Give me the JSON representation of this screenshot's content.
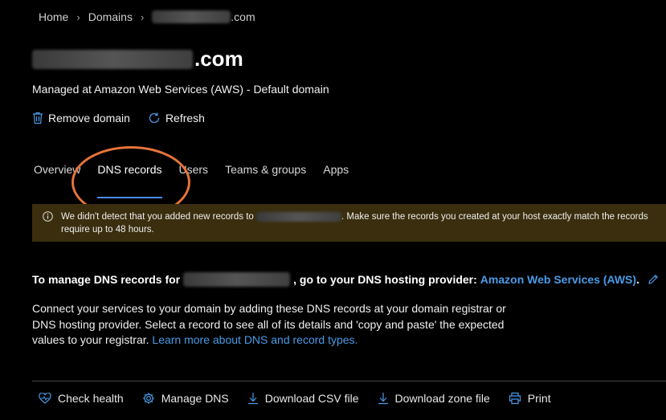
{
  "breadcrumb": {
    "home": "Home",
    "domains": "Domains",
    "domain_suffix": ".com"
  },
  "title": {
    "suffix": ".com"
  },
  "subtitle": "Managed at Amazon Web Services (AWS) - Default domain",
  "commands": {
    "remove": "Remove domain",
    "refresh": "Refresh"
  },
  "tabs": [
    "Overview",
    "DNS records",
    "Users",
    "Teams & groups",
    "Apps"
  ],
  "active_tab": "DNS records",
  "warning": {
    "part1": "We didn't detect that you added new records to",
    "part2": ". Make sure the records you created at your host exactly match the records",
    "line2": "require up to 48 hours."
  },
  "manage": {
    "prefix": "To manage DNS records for",
    "middle": ", go to your DNS hosting provider:",
    "provider": "Amazon Web Services (AWS)",
    "end": "."
  },
  "description": {
    "text": "Connect your services to your domain by adding these DNS records at your domain registrar or DNS hosting provider. Select a record to see all of its details and 'copy and paste' the expected values to your registrar.",
    "link": "Learn more about DNS and record types."
  },
  "bottom_commands": {
    "check_health": "Check health",
    "manage_dns": "Manage DNS",
    "download_csv": "Download CSV file",
    "download_zone": "Download zone file",
    "print": "Print"
  },
  "colors": {
    "accent": "#4a9be8",
    "annotation": "#e8743a",
    "warning_bg": "#3a2e0e"
  }
}
